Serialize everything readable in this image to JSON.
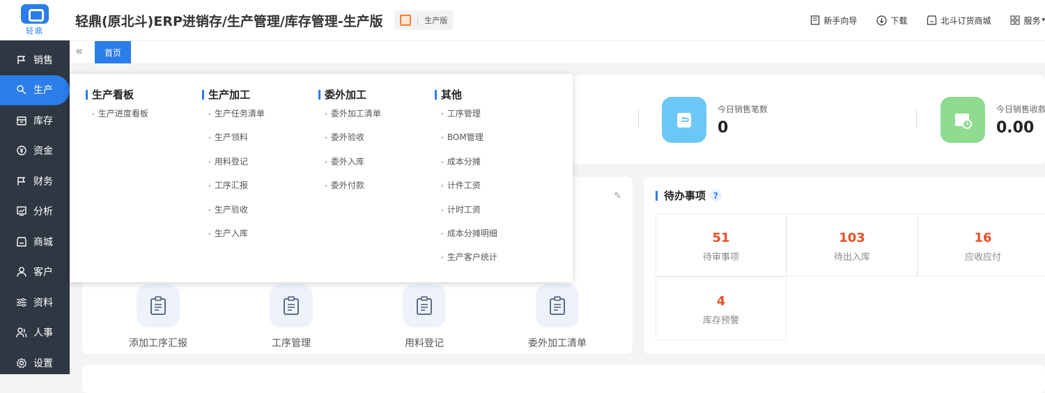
{
  "sidebar": {
    "logo_text": "轻鼎",
    "items": [
      {
        "label": "销售",
        "icon": "flag-icon"
      },
      {
        "label": "生产",
        "icon": "gear-tag-icon"
      },
      {
        "label": "库存",
        "icon": "box-icon"
      },
      {
        "label": "资金",
        "icon": "coin-icon"
      },
      {
        "label": "财务",
        "icon": "flag-icon"
      },
      {
        "label": "分析",
        "icon": "chart-icon"
      },
      {
        "label": "商城",
        "icon": "shop-icon"
      },
      {
        "label": "客户",
        "icon": "user-icon"
      },
      {
        "label": "资料",
        "icon": "sliders-icon"
      },
      {
        "label": "人事",
        "icon": "users-icon"
      },
      {
        "label": "设置",
        "icon": "gear-icon"
      }
    ],
    "active_index": 1
  },
  "header": {
    "title": "轻鼎(原北斗)ERP进销存/生产管理/库存管理-生产版",
    "version_badge": "生产版",
    "links": [
      {
        "label": "新手向导",
        "icon": "book-icon"
      },
      {
        "label": "下载",
        "icon": "download-icon"
      },
      {
        "label": "北斗订货商城",
        "icon": "shop-icon"
      },
      {
        "label": "服务",
        "icon": "grid-icon"
      }
    ]
  },
  "tabs": {
    "home": "首页"
  },
  "stats": [
    {
      "label": "今日销售笔数",
      "value": "0",
      "color": "#6bc7f5"
    },
    {
      "label": "今日销售收款",
      "value": "0.00",
      "color": "#8fdb90"
    }
  ],
  "shortcuts": [
    {
      "label": "添加工序汇报"
    },
    {
      "label": "工序管理"
    },
    {
      "label": "用料登记"
    },
    {
      "label": "委外加工清单"
    }
  ],
  "todo": {
    "title": "待办事项",
    "help": "?",
    "items": [
      {
        "value": "51",
        "label": "待审事项"
      },
      {
        "value": "103",
        "label": "待出入库"
      },
      {
        "value": "16",
        "label": "应收应付"
      },
      {
        "value": "4",
        "label": "库存预警"
      }
    ]
  },
  "dropdown": {
    "columns": [
      {
        "title": "生产看板",
        "items": [
          "生产进度看板"
        ]
      },
      {
        "title": "生产加工",
        "items": [
          "生产任务清单",
          "生产领料",
          "用料登记",
          "工序汇报",
          "生产验收",
          "生产入库"
        ]
      },
      {
        "title": "委外加工",
        "items": [
          "委外加工清单",
          "委外验收",
          "委外入库",
          "委外付款"
        ]
      },
      {
        "title": "其他",
        "items": [
          "工序管理",
          "BOM管理",
          "成本分摊",
          "计件工资",
          "计时工资",
          "成本分摊明细",
          "生产客户统计"
        ]
      }
    ]
  },
  "colors": {
    "accent": "#2b7de9",
    "sidebar_bg": "#2f3742",
    "todo_number": "#e94f26"
  }
}
